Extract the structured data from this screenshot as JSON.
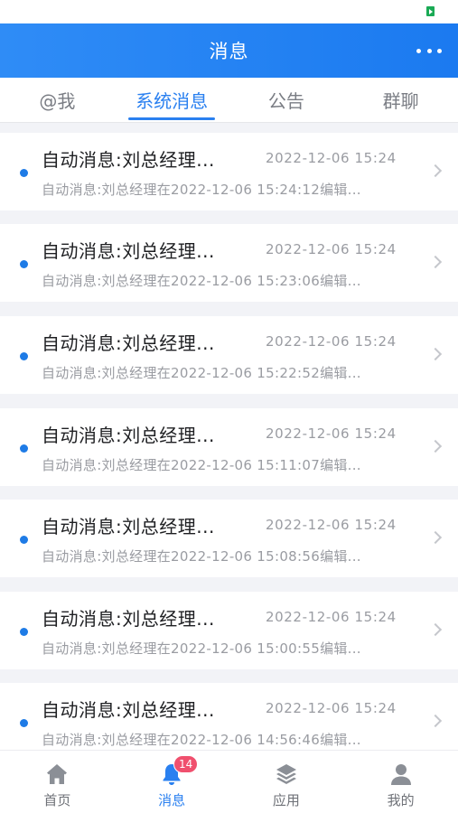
{
  "colors": {
    "header_gradient_start": "#2f8cf6",
    "header_gradient_end": "#1b7af0",
    "accent": "#2a80f0",
    "unread_dot": "#1e7be6",
    "badge": "#f0506e",
    "nav_inactive_icon": "#8b8f96"
  },
  "header": {
    "title": "消息",
    "more_icon": "more-dots-icon"
  },
  "tabs": [
    {
      "label": "@我",
      "active": false
    },
    {
      "label": "系统消息",
      "active": true
    },
    {
      "label": "公告",
      "active": false
    },
    {
      "label": "群聊",
      "active": false
    }
  ],
  "messages": [
    {
      "title": "自动消息:刘总经理...",
      "time": "2022-12-06 15:24",
      "preview": "自动消息:刘总经理在2022-12-06 15:24:12编辑...",
      "unread": true
    },
    {
      "title": "自动消息:刘总经理...",
      "time": "2022-12-06 15:24",
      "preview": "自动消息:刘总经理在2022-12-06 15:23:06编辑...",
      "unread": true
    },
    {
      "title": "自动消息:刘总经理...",
      "time": "2022-12-06 15:24",
      "preview": "自动消息:刘总经理在2022-12-06 15:22:52编辑...",
      "unread": true
    },
    {
      "title": "自动消息:刘总经理...",
      "time": "2022-12-06 15:24",
      "preview": "自动消息:刘总经理在2022-12-06 15:11:07编辑...",
      "unread": true
    },
    {
      "title": "自动消息:刘总经理...",
      "time": "2022-12-06 15:24",
      "preview": "自动消息:刘总经理在2022-12-06 15:08:56编辑...",
      "unread": true
    },
    {
      "title": "自动消息:刘总经理...",
      "time": "2022-12-06 15:24",
      "preview": "自动消息:刘总经理在2022-12-06 15:00:55编辑...",
      "unread": true
    },
    {
      "title": "自动消息:刘总经理...",
      "time": "2022-12-06 15:24",
      "preview": "自动消息:刘总经理在2022-12-06 14:56:46编辑...",
      "unread": true
    }
  ],
  "bottom_nav": [
    {
      "label": "首页",
      "icon": "home-icon",
      "active": false
    },
    {
      "label": "消息",
      "icon": "bell-icon",
      "active": true,
      "badge": "14"
    },
    {
      "label": "应用",
      "icon": "layers-icon",
      "active": false
    },
    {
      "label": "我的",
      "icon": "user-icon",
      "active": false
    }
  ]
}
